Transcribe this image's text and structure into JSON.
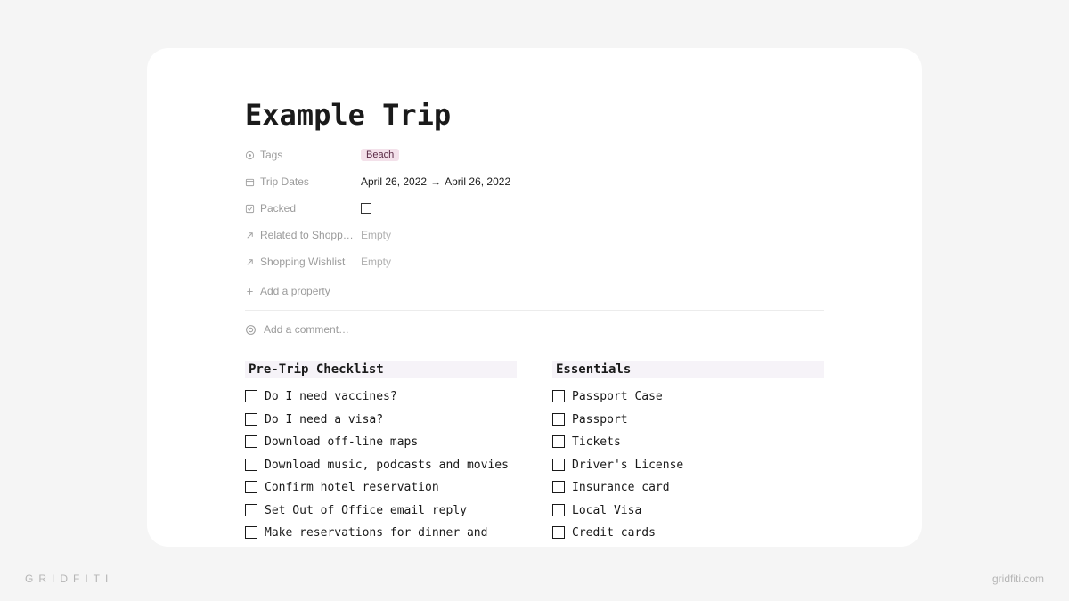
{
  "title": "Example Trip",
  "properties": {
    "tags": {
      "label": "Tags",
      "value": "Beach"
    },
    "trip_dates": {
      "label": "Trip Dates",
      "start": "April 26, 2022",
      "arrow": "→",
      "end": "April 26, 2022"
    },
    "packed": {
      "label": "Packed"
    },
    "related_shopping": {
      "label": "Related to Shopp…",
      "value": "Empty"
    },
    "shopping_wishlist": {
      "label": "Shopping Wishlist",
      "value": "Empty"
    }
  },
  "add_property": "Add a property",
  "comment_placeholder": "Add a comment…",
  "columns": {
    "left": {
      "heading": "Pre-Trip Checklist",
      "items": [
        "Do I need vaccines?",
        "Do I need a visa?",
        "Download off-line maps",
        "Download music, podcasts and movies",
        "Confirm hotel reservation",
        "Set Out of Office email reply",
        "Make reservations for dinner and"
      ]
    },
    "right": {
      "heading": "Essentials",
      "items": [
        "Passport Case",
        "Passport",
        "Tickets",
        "Driver's License",
        "Insurance card",
        "Local Visa",
        "Credit cards"
      ]
    }
  },
  "watermark": {
    "left": "GRIDFITI",
    "right": "gridfiti.com"
  }
}
